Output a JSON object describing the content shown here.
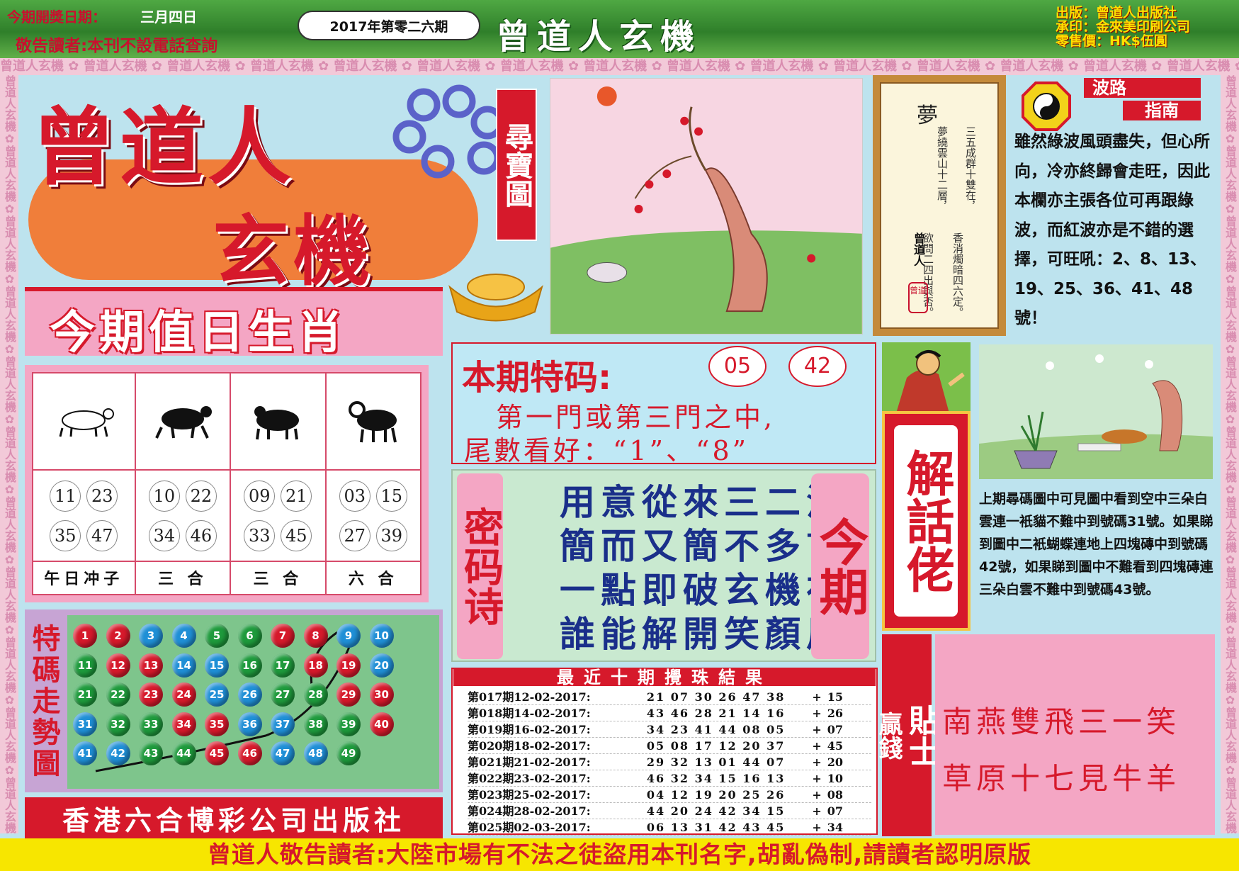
{
  "header": {
    "issue_date_label": "今期開獎日期：",
    "issue_date": "三月四日",
    "notice": "敬告讀者:本刊不設電話查詢",
    "issue_no": "2017年第零二六期",
    "masthead": "曾道人玄機",
    "publisher_info": [
      "出版：曾道人出版社",
      "承印：金來美印刷公司",
      "零售價：HK$伍圓"
    ]
  },
  "brand_strip": "曾道人玄機",
  "logo": {
    "line1": "曾道人",
    "line2": "玄機",
    "treasure_map": "尋寶圖"
  },
  "dream": {
    "title": "夢",
    "lines": [
      "三五成群十雙在，",
      "香消燭暗四六定。",
      "夢繞雲山十二層，",
      "欲問二四出與否。"
    ],
    "author": "曾道人",
    "seal": "曾道"
  },
  "wave": {
    "title_1": "波路",
    "title_2": "指南",
    "text": "雖然綠波風頭盡失，但心所向，冷亦終歸會走旺，因此本欄亦主張各位可再跟綠波，而紅波亦是不錯的選擇，可旺吼：2、8、13、19、25、36、41、48號！"
  },
  "zodiac": {
    "title": "今期值日生肖",
    "columns": [
      {
        "numbers": [
          "11",
          "23",
          "35",
          "47"
        ],
        "label": "午日冲子"
      },
      {
        "numbers": [
          "10",
          "22",
          "34",
          "46"
        ],
        "label": "三 合"
      },
      {
        "numbers": [
          "09",
          "21",
          "33",
          "45"
        ],
        "label": "三 合"
      },
      {
        "numbers": [
          "03",
          "15",
          "27",
          "39"
        ],
        "label": "六 合"
      }
    ]
  },
  "trend": {
    "label": "特碼走勢圖",
    "balls": [
      {
        "n": "1",
        "c": "#d6192b"
      },
      {
        "n": "2",
        "c": "#d6192b"
      },
      {
        "n": "3",
        "c": "#1f8fd6"
      },
      {
        "n": "4",
        "c": "#1f8fd6"
      },
      {
        "n": "5",
        "c": "#1e9a3c"
      },
      {
        "n": "6",
        "c": "#1e9a3c"
      },
      {
        "n": "7",
        "c": "#d6192b"
      },
      {
        "n": "8",
        "c": "#d6192b"
      },
      {
        "n": "9",
        "c": "#1f8fd6"
      },
      {
        "n": "10",
        "c": "#1f8fd6"
      },
      {
        "n": "11",
        "c": "#1e9a3c"
      },
      {
        "n": "12",
        "c": "#d6192b"
      },
      {
        "n": "13",
        "c": "#d6192b"
      },
      {
        "n": "14",
        "c": "#1f8fd6"
      },
      {
        "n": "15",
        "c": "#1f8fd6"
      },
      {
        "n": "16",
        "c": "#1e9a3c"
      },
      {
        "n": "17",
        "c": "#1e9a3c"
      },
      {
        "n": "18",
        "c": "#d6192b"
      },
      {
        "n": "19",
        "c": "#d6192b"
      },
      {
        "n": "20",
        "c": "#1f8fd6"
      },
      {
        "n": "21",
        "c": "#1e9a3c"
      },
      {
        "n": "22",
        "c": "#1e9a3c"
      },
      {
        "n": "23",
        "c": "#d6192b"
      },
      {
        "n": "24",
        "c": "#d6192b"
      },
      {
        "n": "25",
        "c": "#1f8fd6"
      },
      {
        "n": "26",
        "c": "#1f8fd6"
      },
      {
        "n": "27",
        "c": "#1e9a3c"
      },
      {
        "n": "28",
        "c": "#1e9a3c"
      },
      {
        "n": "29",
        "c": "#d6192b"
      },
      {
        "n": "30",
        "c": "#d6192b"
      },
      {
        "n": "31",
        "c": "#1f8fd6"
      },
      {
        "n": "32",
        "c": "#1e9a3c"
      },
      {
        "n": "33",
        "c": "#1e9a3c"
      },
      {
        "n": "34",
        "c": "#d6192b"
      },
      {
        "n": "35",
        "c": "#d6192b"
      },
      {
        "n": "36",
        "c": "#1f8fd6"
      },
      {
        "n": "37",
        "c": "#1f8fd6"
      },
      {
        "n": "38",
        "c": "#1e9a3c"
      },
      {
        "n": "39",
        "c": "#1e9a3c"
      },
      {
        "n": "40",
        "c": "#d6192b"
      },
      {
        "n": "41",
        "c": "#1f8fd6"
      },
      {
        "n": "42",
        "c": "#1f8fd6"
      },
      {
        "n": "43",
        "c": "#1e9a3c"
      },
      {
        "n": "44",
        "c": "#1e9a3c"
      },
      {
        "n": "45",
        "c": "#d6192b"
      },
      {
        "n": "46",
        "c": "#d6192b"
      },
      {
        "n": "47",
        "c": "#1f8fd6"
      },
      {
        "n": "48",
        "c": "#1f8fd6"
      },
      {
        "n": "49",
        "c": "#1e9a3c"
      }
    ],
    "publisher": "香港六合博彩公司出版社"
  },
  "special": {
    "title": "本期特码:",
    "num_1": "05",
    "num_2": "42",
    "line_1": "第一門或第三門之中,",
    "line_2": "尾數看好：“1”、“8”"
  },
  "poem": {
    "label": "密码诗",
    "lines": [
      "用意從來三二活",
      "簡而又簡不多言",
      "一點即破玄機在",
      "誰能解開笑顏眉"
    ],
    "side_label": "今期"
  },
  "results": {
    "title": "最近十期攪珠結果",
    "rows": [
      {
        "label": "第017期12-02-2017:",
        "nums": "21 07 30 26 47 38",
        "special": "15"
      },
      {
        "label": "第018期14-02-2017:",
        "nums": "43 46 28 21 14 16",
        "special": "26"
      },
      {
        "label": "第019期16-02-2017:",
        "nums": "34 23 41 44 08 05",
        "special": "07"
      },
      {
        "label": "第020期18-02-2017:",
        "nums": "05 08 17 12 20 37",
        "special": "45"
      },
      {
        "label": "第021期21-02-2017:",
        "nums": "29 32 13 01 44 07",
        "special": "20"
      },
      {
        "label": "第022期23-02-2017:",
        "nums": "46 32 34 15 16 13",
        "special": "10"
      },
      {
        "label": "第023期25-02-2017:",
        "nums": "04 12 19 20 25 26",
        "special": "08"
      },
      {
        "label": "第024期28-02-2017:",
        "nums": "44 20 24 42 34 15",
        "special": "07"
      },
      {
        "label": "第025期02-03-2017:",
        "nums": "06 13 31 42 43 45",
        "special": "34"
      }
    ]
  },
  "solver": {
    "label": "解話佬",
    "text": "上期尋碼圖中可見圖中看到空中三朵白雲連一衹貓不難中到號碼31號。如果睇到圖中二衹蝴蝶連地上四塊磚中到號碼42號，如果睇到圖中不難看到四塊磚連三朵白雲不難中到號碼43號。"
  },
  "tips": {
    "label_a": "贏錢",
    "label_b": "貼士",
    "line_1": "南燕雙飛三一笑",
    "line_2": "草原十七見牛羊"
  },
  "footer": {
    "notice": "曾道人敬告讀者:大陸市場有不法之徒盜用本刊名字,胡亂偽制,請讀者認明原版"
  }
}
